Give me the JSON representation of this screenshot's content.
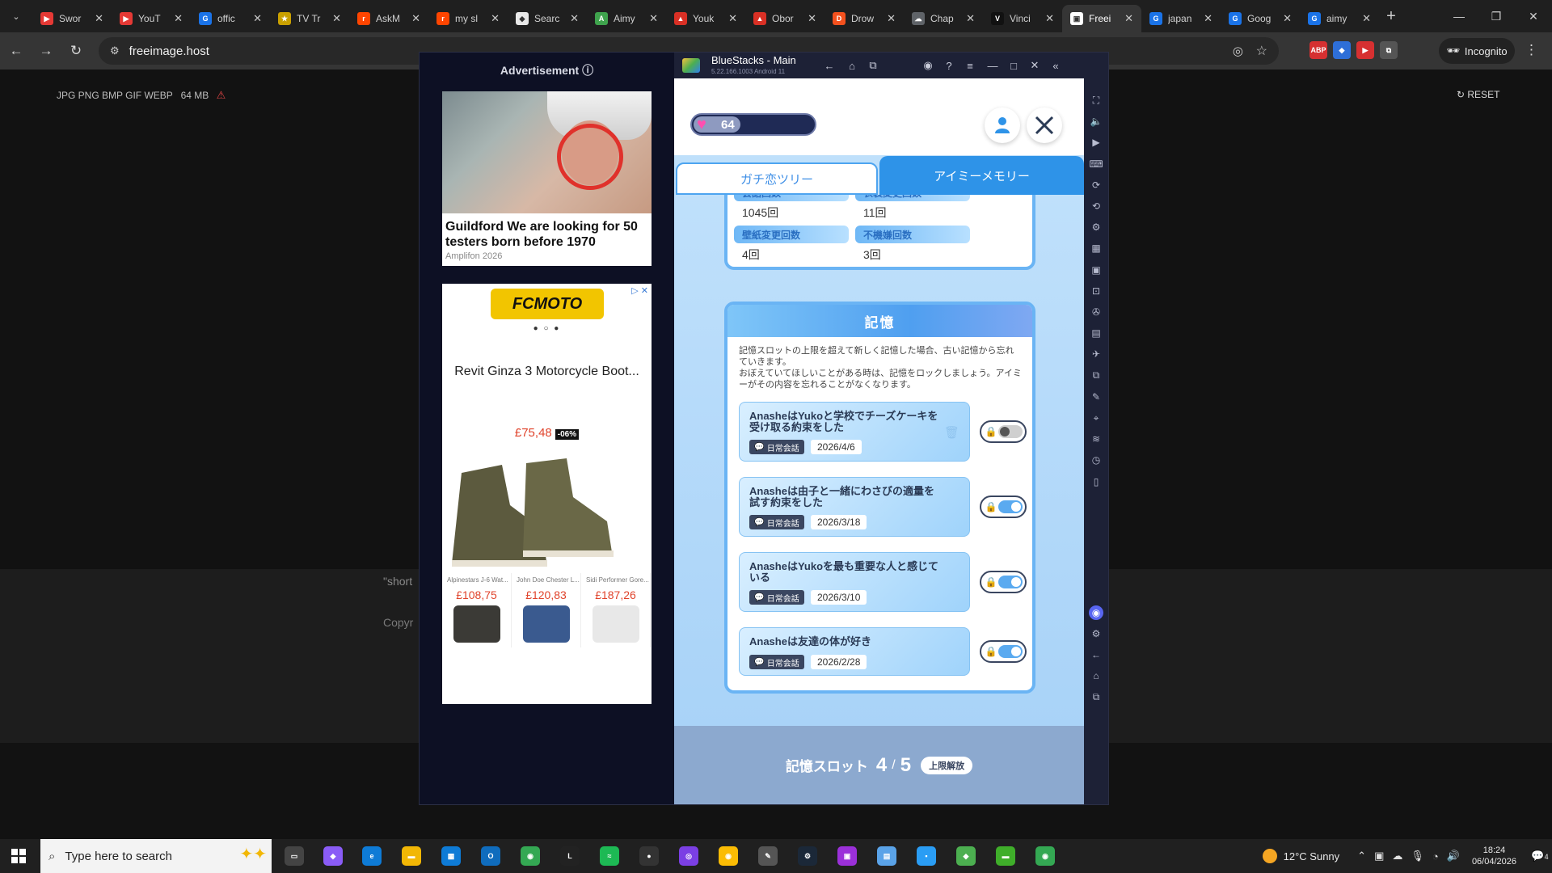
{
  "browser": {
    "tabs": [
      {
        "title": "Swor",
        "color": "#e53935",
        "glyph": "▶"
      },
      {
        "title": "YouT",
        "color": "#e53935",
        "glyph": "▶"
      },
      {
        "title": "offic",
        "color": "#1a73e8",
        "glyph": "G"
      },
      {
        "title": "TV Tr",
        "color": "#c9a000",
        "glyph": "★"
      },
      {
        "title": "AskM",
        "color": "#ff4500",
        "glyph": "r"
      },
      {
        "title": "my sl",
        "color": "#ff4500",
        "glyph": "r"
      },
      {
        "title": "Searc",
        "color": "#e8e8e8",
        "glyph": "◆"
      },
      {
        "title": "Aimy",
        "color": "#3fa34d",
        "glyph": "A"
      },
      {
        "title": "Youk",
        "color": "#d93025",
        "glyph": "▲"
      },
      {
        "title": "Obor",
        "color": "#d93025",
        "glyph": "▲"
      },
      {
        "title": "Drow",
        "color": "#f4511e",
        "glyph": "D"
      },
      {
        "title": "Chap",
        "color": "#5f6368",
        "glyph": "☁"
      },
      {
        "title": "Vinci",
        "color": "#111111",
        "glyph": "V"
      },
      {
        "title": "Freei",
        "color": "#ffffff",
        "glyph": "▣",
        "active": true
      },
      {
        "title": "japan",
        "color": "#1a73e8",
        "glyph": "G"
      },
      {
        "title": "Goog",
        "color": "#1a73e8",
        "glyph": "G"
      },
      {
        "title": "aimy",
        "color": "#1a73e8",
        "glyph": "G"
      }
    ],
    "url": "freeimage.host",
    "incognito_label": "Incognito",
    "extensions": [
      {
        "label": "ABP",
        "color": "#d63031"
      },
      {
        "label": "◆",
        "color": "#2e6fd8"
      },
      {
        "label": "▶",
        "color": "#d63031"
      },
      {
        "label": "⧉",
        "color": "#555555"
      }
    ]
  },
  "page": {
    "formats": "JPG PNG BMP GIF WEBP",
    "size": "64 MB",
    "reset_label": "RESET",
    "fragment1": "\"short",
    "fragment2": "Copyr"
  },
  "ads": {
    "label": "Advertisement",
    "ad1_title": "Guildford We are looking for 50 testers born before 1970",
    "ad1_source": "Amplifon 2026",
    "ad2_brand": "FCMOTO",
    "ad2_product": "Revit Ginza 3 Motorcycle Boot...",
    "ad2_price": "£75,48",
    "ad2_discount": "-06%",
    "ad2_items": [
      {
        "name": "Alpinestars J-6 Wat...",
        "price": "£108,75"
      },
      {
        "name": "John Doe Chester L...",
        "price": "£120,83"
      },
      {
        "name": "Sidi Performer Gore...",
        "price": "£187,26"
      }
    ]
  },
  "bluestacks": {
    "title": "BlueStacks - Main",
    "version": "5.22.166.1003  Android 11"
  },
  "game": {
    "hearts": "64",
    "tabs": {
      "tree": "ガチ恋ツリー",
      "memory": "アイミーメモリー"
    },
    "stats": [
      {
        "label": "会話回数",
        "value": "1045回"
      },
      {
        "label": "衣装変更回数",
        "value": "11回"
      },
      {
        "label": "壁紙変更回数",
        "value": "4回"
      },
      {
        "label": "不機嫌回数",
        "value": "3回"
      }
    ],
    "memory_title": "記憶",
    "memory_desc1": "記憶スロットの上限を超えて新しく記憶した場合、古い記憶から忘れていきます。",
    "memory_desc2": "おぼえていてほしいことがある時は、記憶をロックしましょう。アイミーがその内容を忘れることがなくなります。",
    "memories": [
      {
        "text": "AnasheはYukoと学校でチーズケーキを受け取る約束をした",
        "tag": "日常会話",
        "date": "2026/4/6",
        "locked": false
      },
      {
        "text": "Anasheは由子と一緒にわさびの適量を試す約束をした",
        "tag": "日常会話",
        "date": "2026/3/18",
        "locked": true
      },
      {
        "text": "AnasheはYukoを最も重要な人と感じている",
        "tag": "日常会話",
        "date": "2026/3/10",
        "locked": true
      },
      {
        "text": "Anasheは友達の体が好き",
        "tag": "日常会話",
        "date": "2026/2/28",
        "locked": true
      }
    ],
    "slot_label": "記憶スロット",
    "slot_used": "4",
    "slot_sep": "/",
    "slot_total": "5",
    "slot_button": "上限解放"
  },
  "taskbar": {
    "search_placeholder": "Type here to search",
    "weather": "12°C  Sunny",
    "time": "18:24",
    "date": "06/04/2026",
    "notifications": "4"
  }
}
